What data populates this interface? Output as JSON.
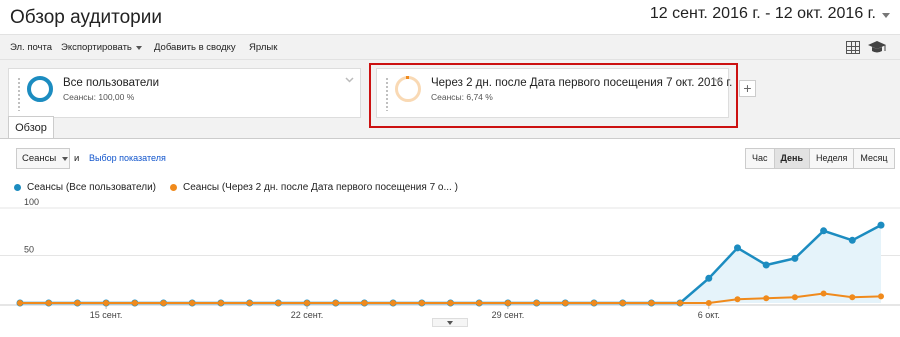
{
  "header": {
    "title": "Обзор аудитории",
    "date_range": "12 сент. 2016 г. - 12 окт. 2016 г."
  },
  "toolbar": {
    "email": "Эл. почта",
    "export": "Экспортировать",
    "add_to_dashboard": "Добавить в сводку",
    "shortcut": "Ярлык"
  },
  "segments": [
    {
      "label": "Все пользователи",
      "sub": "Сеансы: 100,00 %",
      "color": "#1c8cc0"
    },
    {
      "label": "Через 2 дн. после Дата первого посещения 7 окт. 2016 г.",
      "sub": "Сеансы: 6,74 %",
      "color": "#f09a3a"
    }
  ],
  "tabs": {
    "overview": "Обзор"
  },
  "controls": {
    "metric": "Сеансы",
    "and": "и",
    "choose_metric": "Выбор показателя",
    "periods": [
      "Час",
      "День",
      "Неделя",
      "Месяц"
    ],
    "active_period": "День"
  },
  "chart_data": {
    "type": "area",
    "ylim": [
      0,
      100
    ],
    "yticks": [
      100,
      50
    ],
    "x_tick_labels": [
      "15 сент.",
      "22 сент.",
      "29 сент.",
      "6 окт."
    ],
    "x_tick_index": [
      3,
      10,
      17,
      24
    ],
    "series": [
      {
        "name": "Сеансы (Все пользователи)",
        "color": "#1c8cc0",
        "values": [
          0,
          0,
          0,
          0,
          0,
          0,
          0,
          0,
          0,
          0,
          0,
          0,
          0,
          0,
          0,
          0,
          0,
          0,
          0,
          0,
          0,
          0,
          0,
          0,
          26,
          58,
          40,
          47,
          76,
          66,
          82
        ]
      },
      {
        "name": "Сеансы (Через 2 дн. после Дата первого посещения 7 о... )",
        "color": "#f08a1c",
        "values": [
          0,
          0,
          0,
          0,
          0,
          0,
          0,
          0,
          0,
          0,
          0,
          0,
          0,
          0,
          0,
          0,
          0,
          0,
          0,
          0,
          0,
          0,
          0,
          0,
          0,
          4,
          5,
          6,
          10,
          6,
          7
        ]
      }
    ]
  }
}
